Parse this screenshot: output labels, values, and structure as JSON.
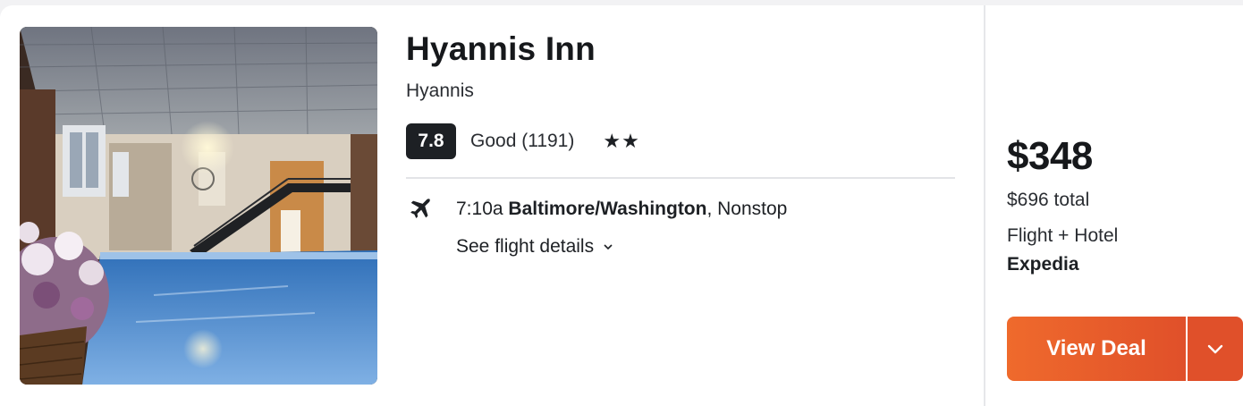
{
  "hotel": {
    "name": "Hyannis Inn",
    "city": "Hyannis",
    "score": "7.8",
    "rating_text": "Good (1191)",
    "stars": "★★",
    "star_count": 2,
    "photo_description_icon": "indoor-pool-photo"
  },
  "flight": {
    "time": "7:10a",
    "airport": "Baltimore/Washington",
    "stops": ", Nonstop",
    "details_link": "See flight details",
    "icon": "airplane-icon"
  },
  "pricing": {
    "price": "$348",
    "total": "$696 total",
    "package": "Flight + Hotel",
    "provider": "Expedia",
    "cta_label": "View Deal",
    "cta_color": "#e8582a"
  },
  "colors": {
    "badge_bg": "#1d2024",
    "accent": "#ef6a2c"
  }
}
